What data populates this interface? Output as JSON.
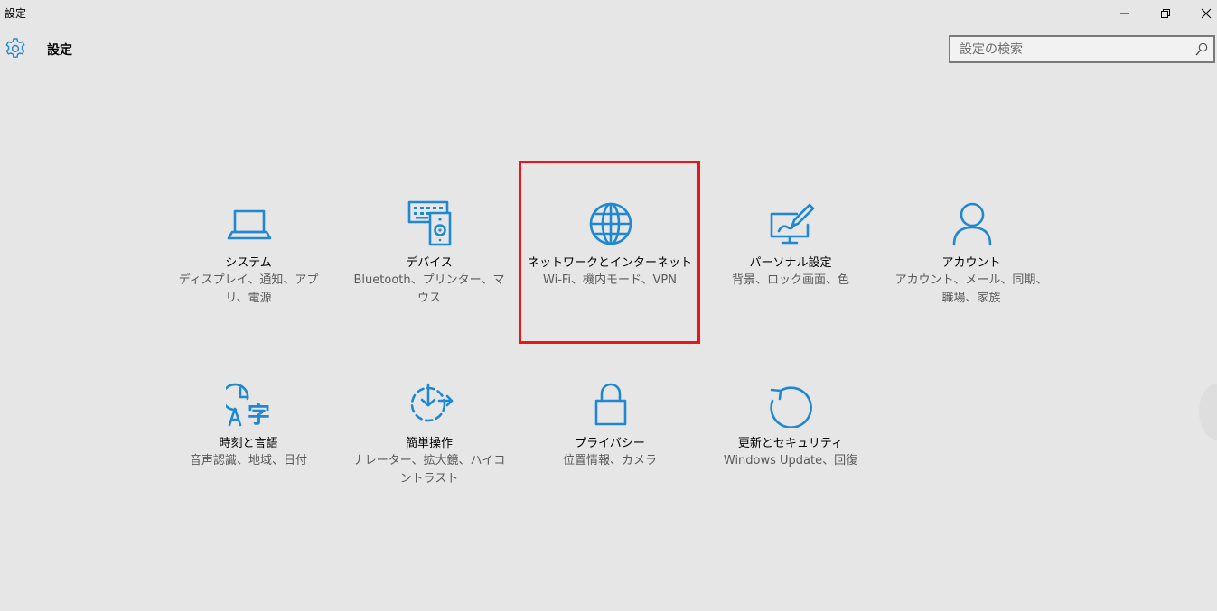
{
  "window": {
    "title": "設定",
    "controls": [
      "minimize-icon",
      "restore-icon",
      "close-icon"
    ]
  },
  "header": {
    "icon": "gear-icon",
    "title": "設定"
  },
  "search": {
    "placeholder": "設定の検索",
    "icon": "search-icon"
  },
  "accent_color": "#1f88d0",
  "highlight_color": "#e8161a",
  "tiles": [
    {
      "icon": "laptop-icon",
      "label": "システム",
      "description": "ディスプレイ、通知、アプリ、電源"
    },
    {
      "icon": "keyboard-speaker-icon",
      "label": "デバイス",
      "description": "Bluetooth、プリンター、マウス"
    },
    {
      "icon": "globe-icon",
      "label": "ネットワークとインターネット",
      "description": "Wi-Fi、機内モード、VPN",
      "highlighted": true
    },
    {
      "icon": "monitor-pen-icon",
      "label": "パーソナル設定",
      "description": "背景、ロック画面、色"
    },
    {
      "icon": "person-icon",
      "label": "アカウント",
      "description": "アカウント、メール、同期、職場、家族"
    },
    {
      "icon": "clock-language-icon",
      "label": "時刻と言語",
      "description": "音声認識、地域、日付"
    },
    {
      "icon": "ease-of-access-icon",
      "label": "簡単操作",
      "description": "ナレーター、拡大鏡、ハイコントラスト"
    },
    {
      "icon": "lock-icon",
      "label": "プライバシー",
      "description": "位置情報、カメラ"
    },
    {
      "icon": "refresh-icon",
      "label": "更新とセキュリティ",
      "description": "Windows Update、回復"
    }
  ]
}
